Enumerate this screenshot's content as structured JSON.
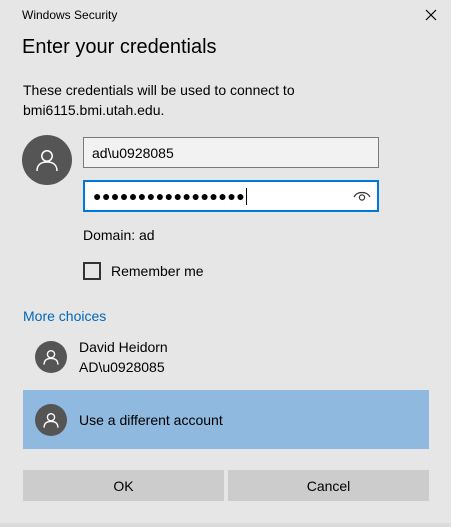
{
  "window": {
    "title": "Windows Security"
  },
  "dialog": {
    "heading": "Enter your credentials",
    "description_line1": "These credentials will be used to connect to",
    "description_line2": "bmi6115.bmi.utah.edu."
  },
  "form": {
    "username_value": "ad\\u0928085",
    "password_mask": "●●●●●●●●●●●●●●●●●",
    "domain_text": "Domain: ad",
    "remember_label": "Remember me",
    "remember_checked": false
  },
  "more_choices": {
    "label": "More choices",
    "accounts": [
      {
        "name": "David Heidorn",
        "user": "AD\\u0928085"
      },
      {
        "name": "Use a different account",
        "selected": true
      }
    ]
  },
  "buttons": {
    "ok": "OK",
    "cancel": "Cancel"
  },
  "icons": {
    "close": "close-icon",
    "avatar": "user-avatar-icon",
    "reveal": "eye-icon"
  },
  "colors": {
    "background": "#e6e6e6",
    "link": "#0067b8",
    "focus_border": "#0078d7",
    "selected_row": "#8fb9de",
    "button": "#cccccc"
  }
}
